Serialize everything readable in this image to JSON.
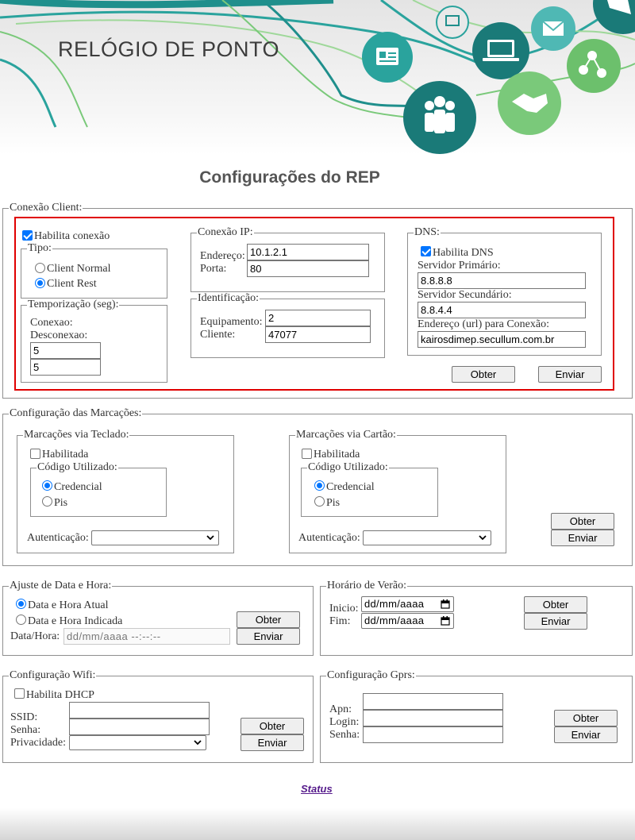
{
  "header": {
    "app_title": "RELÓGIO DE PONTO",
    "page_title": "Configurações do REP"
  },
  "colors": {
    "teal": "#1f8f8c",
    "green": "#7ac97a",
    "highlight": "#e00000",
    "accent": "#0075ff",
    "link": "#551a8b"
  },
  "conexao_client": {
    "legend": "Conexão Client:",
    "habilita_conexao": {
      "label": "Habilita conexão",
      "checked": true
    },
    "tipo": {
      "legend": "Tipo:",
      "options": [
        {
          "label": "Client Normal",
          "selected": false
        },
        {
          "label": "Client Rest",
          "selected": true
        }
      ]
    },
    "temporizacao": {
      "legend": "Temporização (seg):",
      "conexao_label": "Conexao:",
      "desconexao_label": "Desconexao:",
      "conexao_value": "5",
      "desconexao_value": "5"
    },
    "conexao_ip": {
      "legend": "Conexão IP:",
      "endereco_label": "Endereço:",
      "porta_label": "Porta:",
      "endereco_value": "10.1.2.1",
      "porta_value": "80"
    },
    "identificacao": {
      "legend": "Identificação:",
      "equipamento_label": "Equipamento:",
      "cliente_label": "Cliente:",
      "equipamento_value": "2",
      "cliente_value": "47077"
    },
    "dns": {
      "legend": "DNS:",
      "habilita_dns": {
        "label": "Habilita DNS",
        "checked": true
      },
      "primario_label": "Servidor Primário:",
      "primario_value": "8.8.8.8",
      "secundario_label": "Servidor Secundário:",
      "secundario_value": "8.8.4.4",
      "url_label": "Endereço (url) para Conexão:",
      "url_value": "kairosdimep.secullum.com.br"
    },
    "obter": "Obter",
    "enviar": "Enviar"
  },
  "marcacoes": {
    "legend": "Configuração das Marcações:",
    "teclado": {
      "legend": "Marcações via Teclado:",
      "habilitada": {
        "label": "Habilitada",
        "checked": false
      },
      "codigo_legend": "Código Utilizado:",
      "options": [
        {
          "label": "Credencial",
          "selected": true
        },
        {
          "label": "Pis",
          "selected": false
        }
      ],
      "autenticacao_label": "Autenticação:",
      "autenticacao_value": ""
    },
    "cartao": {
      "legend": "Marcações via Cartão:",
      "habilitada": {
        "label": "Habilitada",
        "checked": false
      },
      "codigo_legend": "Código Utilizado:",
      "options": [
        {
          "label": "Credencial",
          "selected": true
        },
        {
          "label": "Pis",
          "selected": false
        }
      ],
      "autenticacao_label": "Autenticação:",
      "autenticacao_value": ""
    },
    "obter": "Obter",
    "enviar": "Enviar"
  },
  "data_hora": {
    "legend": "Ajuste de Data e Hora:",
    "options": [
      {
        "label": "Data e Hora Atual",
        "selected": true
      },
      {
        "label": "Data e Hora Indicada",
        "selected": false
      }
    ],
    "datahora_label": "Data/Hora:",
    "datahora_placeholder": "dd/mm/aaaa  --:--:--",
    "obter": "Obter",
    "enviar": "Enviar"
  },
  "horario_verao": {
    "legend": "Horário de Verão:",
    "inicio_label": "Inicio:",
    "fim_label": "Fim:",
    "inicio_placeholder": "dd/mm/aaaa",
    "fim_placeholder": "dd/mm/aaaa",
    "obter": "Obter",
    "enviar": "Enviar"
  },
  "wifi": {
    "legend": "Configuração Wifi:",
    "habilita_dhcp": {
      "label": "Habilita DHCP",
      "checked": false
    },
    "ssid_label": "SSID:",
    "senha_label": "Senha:",
    "privacidade_label": "Privacidade:",
    "ssid_value": "",
    "senha_value": "",
    "privacidade_value": "",
    "obter": "Obter",
    "enviar": "Enviar"
  },
  "gprs": {
    "legend": "Configuração Gprs:",
    "apn_label": "Apn:",
    "login_label": "Login:",
    "senha_label": "Senha:",
    "apn_value": "",
    "login_value": "",
    "senha_value": "",
    "obter": "Obter",
    "enviar": "Enviar"
  },
  "footer": {
    "status_link": "Status"
  }
}
